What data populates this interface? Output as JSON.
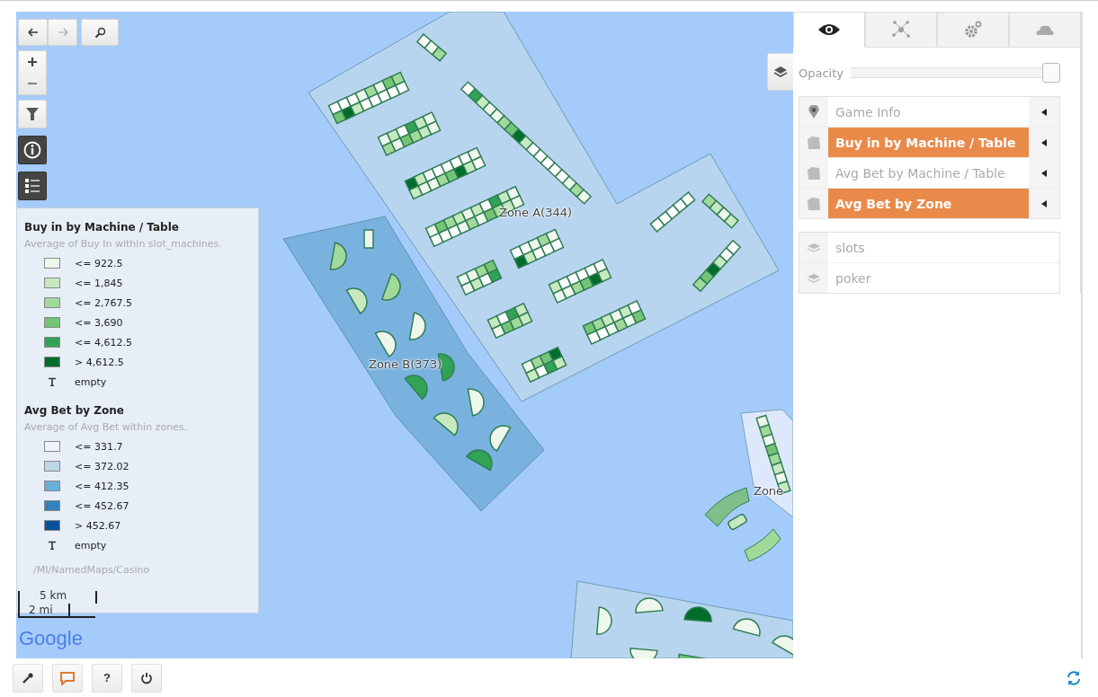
{
  "map": {
    "zone_labels": [
      {
        "text": "Zone A(344)"
      },
      {
        "text": "Zone B(373)"
      },
      {
        "text": "Zone"
      }
    ],
    "scale": {
      "metric": "5 km",
      "imperial": "2 mi"
    },
    "logo": "Google"
  },
  "legend": {
    "sections": [
      {
        "title": "Buy in by Machine / Table",
        "subtitle": "Average of Buy In within slot_machines.",
        "items": [
          {
            "kind": "swatch",
            "color": "#eef7ec",
            "label": "<= 922.5"
          },
          {
            "kind": "swatch",
            "color": "#c7e9c0",
            "label": "<= 1,845"
          },
          {
            "kind": "swatch",
            "color": "#a1d99b",
            "label": "<= 2,767.5"
          },
          {
            "kind": "swatch",
            "color": "#74c476",
            "label": "<= 3,690"
          },
          {
            "kind": "swatch",
            "color": "#31a354",
            "label": "<= 4,612.5"
          },
          {
            "kind": "swatch",
            "color": "#006d2c",
            "label": "> 4,612.5"
          },
          {
            "kind": "empty",
            "label": "empty"
          }
        ]
      },
      {
        "title": "Avg Bet by Zone",
        "subtitle": "Average of Avg Bet within zones.",
        "items": [
          {
            "kind": "swatch",
            "color": "#eff3ff",
            "label": "<= 331.7"
          },
          {
            "kind": "swatch",
            "color": "#bdd7e7",
            "label": "<= 372.02"
          },
          {
            "kind": "swatch",
            "color": "#6baed6",
            "label": "<= 412.35"
          },
          {
            "kind": "swatch",
            "color": "#3182bd",
            "label": "<= 452.67"
          },
          {
            "kind": "swatch",
            "color": "#08519c",
            "label": "> 452.67"
          },
          {
            "kind": "empty",
            "label": "empty"
          }
        ]
      }
    ],
    "path": "/MI/NamedMaps/Casino"
  },
  "panel": {
    "tabs": [
      {
        "selected": true
      },
      {
        "selected": false
      },
      {
        "selected": false
      },
      {
        "selected": false
      }
    ],
    "opacity": {
      "label": "Opacity",
      "level": 1
    },
    "layers": [
      {
        "kind": "marker",
        "label": "Game Info",
        "selected": false
      },
      {
        "kind": "area",
        "label": "Buy in by Machine / Table",
        "selected": true
      },
      {
        "kind": "area",
        "label": "Avg Bet by Machine / Table",
        "selected": false
      },
      {
        "kind": "area",
        "label": "Avg Bet by Zone",
        "selected": true
      }
    ],
    "base_layers": [
      {
        "label": "slots"
      },
      {
        "label": "poker"
      }
    ]
  },
  "bottom_toolbar": {
    "help_label": "?"
  }
}
